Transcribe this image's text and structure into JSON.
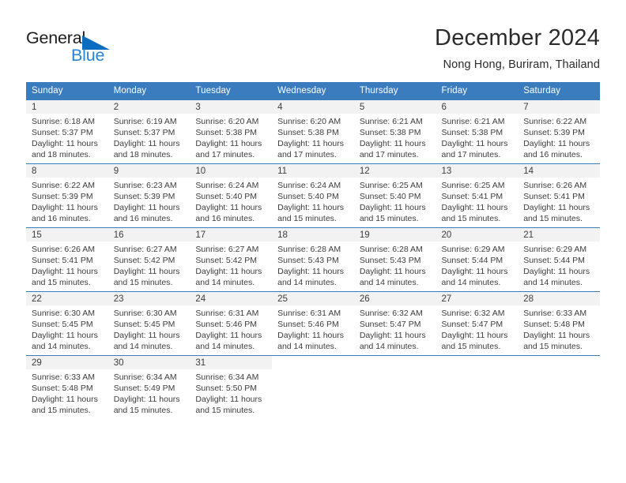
{
  "brand": {
    "word1": "General",
    "word2": "Blue",
    "triangle_color": "#0b6dc0",
    "blue_color": "#2585d3"
  },
  "header": {
    "month_title": "December 2024",
    "location": "Nong Hong, Buriram, Thailand"
  },
  "theme": {
    "header_bg": "#3a7cbe",
    "header_text": "#ffffff",
    "band_bg": "#f2f2f2",
    "text": "#3c3c3c"
  },
  "weekday_headers": [
    "Sunday",
    "Monday",
    "Tuesday",
    "Wednesday",
    "Thursday",
    "Friday",
    "Saturday"
  ],
  "weeks": [
    [
      {
        "day": "1",
        "sunrise": "Sunrise: 6:18 AM",
        "sunset": "Sunset: 5:37 PM",
        "daylight1": "Daylight: 11 hours",
        "daylight2": "and 18 minutes."
      },
      {
        "day": "2",
        "sunrise": "Sunrise: 6:19 AM",
        "sunset": "Sunset: 5:37 PM",
        "daylight1": "Daylight: 11 hours",
        "daylight2": "and 18 minutes."
      },
      {
        "day": "3",
        "sunrise": "Sunrise: 6:20 AM",
        "sunset": "Sunset: 5:38 PM",
        "daylight1": "Daylight: 11 hours",
        "daylight2": "and 17 minutes."
      },
      {
        "day": "4",
        "sunrise": "Sunrise: 6:20 AM",
        "sunset": "Sunset: 5:38 PM",
        "daylight1": "Daylight: 11 hours",
        "daylight2": "and 17 minutes."
      },
      {
        "day": "5",
        "sunrise": "Sunrise: 6:21 AM",
        "sunset": "Sunset: 5:38 PM",
        "daylight1": "Daylight: 11 hours",
        "daylight2": "and 17 minutes."
      },
      {
        "day": "6",
        "sunrise": "Sunrise: 6:21 AM",
        "sunset": "Sunset: 5:38 PM",
        "daylight1": "Daylight: 11 hours",
        "daylight2": "and 17 minutes."
      },
      {
        "day": "7",
        "sunrise": "Sunrise: 6:22 AM",
        "sunset": "Sunset: 5:39 PM",
        "daylight1": "Daylight: 11 hours",
        "daylight2": "and 16 minutes."
      }
    ],
    [
      {
        "day": "8",
        "sunrise": "Sunrise: 6:22 AM",
        "sunset": "Sunset: 5:39 PM",
        "daylight1": "Daylight: 11 hours",
        "daylight2": "and 16 minutes."
      },
      {
        "day": "9",
        "sunrise": "Sunrise: 6:23 AM",
        "sunset": "Sunset: 5:39 PM",
        "daylight1": "Daylight: 11 hours",
        "daylight2": "and 16 minutes."
      },
      {
        "day": "10",
        "sunrise": "Sunrise: 6:24 AM",
        "sunset": "Sunset: 5:40 PM",
        "daylight1": "Daylight: 11 hours",
        "daylight2": "and 16 minutes."
      },
      {
        "day": "11",
        "sunrise": "Sunrise: 6:24 AM",
        "sunset": "Sunset: 5:40 PM",
        "daylight1": "Daylight: 11 hours",
        "daylight2": "and 15 minutes."
      },
      {
        "day": "12",
        "sunrise": "Sunrise: 6:25 AM",
        "sunset": "Sunset: 5:40 PM",
        "daylight1": "Daylight: 11 hours",
        "daylight2": "and 15 minutes."
      },
      {
        "day": "13",
        "sunrise": "Sunrise: 6:25 AM",
        "sunset": "Sunset: 5:41 PM",
        "daylight1": "Daylight: 11 hours",
        "daylight2": "and 15 minutes."
      },
      {
        "day": "14",
        "sunrise": "Sunrise: 6:26 AM",
        "sunset": "Sunset: 5:41 PM",
        "daylight1": "Daylight: 11 hours",
        "daylight2": "and 15 minutes."
      }
    ],
    [
      {
        "day": "15",
        "sunrise": "Sunrise: 6:26 AM",
        "sunset": "Sunset: 5:41 PM",
        "daylight1": "Daylight: 11 hours",
        "daylight2": "and 15 minutes."
      },
      {
        "day": "16",
        "sunrise": "Sunrise: 6:27 AM",
        "sunset": "Sunset: 5:42 PM",
        "daylight1": "Daylight: 11 hours",
        "daylight2": "and 15 minutes."
      },
      {
        "day": "17",
        "sunrise": "Sunrise: 6:27 AM",
        "sunset": "Sunset: 5:42 PM",
        "daylight1": "Daylight: 11 hours",
        "daylight2": "and 14 minutes."
      },
      {
        "day": "18",
        "sunrise": "Sunrise: 6:28 AM",
        "sunset": "Sunset: 5:43 PM",
        "daylight1": "Daylight: 11 hours",
        "daylight2": "and 14 minutes."
      },
      {
        "day": "19",
        "sunrise": "Sunrise: 6:28 AM",
        "sunset": "Sunset: 5:43 PM",
        "daylight1": "Daylight: 11 hours",
        "daylight2": "and 14 minutes."
      },
      {
        "day": "20",
        "sunrise": "Sunrise: 6:29 AM",
        "sunset": "Sunset: 5:44 PM",
        "daylight1": "Daylight: 11 hours",
        "daylight2": "and 14 minutes."
      },
      {
        "day": "21",
        "sunrise": "Sunrise: 6:29 AM",
        "sunset": "Sunset: 5:44 PM",
        "daylight1": "Daylight: 11 hours",
        "daylight2": "and 14 minutes."
      }
    ],
    [
      {
        "day": "22",
        "sunrise": "Sunrise: 6:30 AM",
        "sunset": "Sunset: 5:45 PM",
        "daylight1": "Daylight: 11 hours",
        "daylight2": "and 14 minutes."
      },
      {
        "day": "23",
        "sunrise": "Sunrise: 6:30 AM",
        "sunset": "Sunset: 5:45 PM",
        "daylight1": "Daylight: 11 hours",
        "daylight2": "and 14 minutes."
      },
      {
        "day": "24",
        "sunrise": "Sunrise: 6:31 AM",
        "sunset": "Sunset: 5:46 PM",
        "daylight1": "Daylight: 11 hours",
        "daylight2": "and 14 minutes."
      },
      {
        "day": "25",
        "sunrise": "Sunrise: 6:31 AM",
        "sunset": "Sunset: 5:46 PM",
        "daylight1": "Daylight: 11 hours",
        "daylight2": "and 14 minutes."
      },
      {
        "day": "26",
        "sunrise": "Sunrise: 6:32 AM",
        "sunset": "Sunset: 5:47 PM",
        "daylight1": "Daylight: 11 hours",
        "daylight2": "and 14 minutes."
      },
      {
        "day": "27",
        "sunrise": "Sunrise: 6:32 AM",
        "sunset": "Sunset: 5:47 PM",
        "daylight1": "Daylight: 11 hours",
        "daylight2": "and 15 minutes."
      },
      {
        "day": "28",
        "sunrise": "Sunrise: 6:33 AM",
        "sunset": "Sunset: 5:48 PM",
        "daylight1": "Daylight: 11 hours",
        "daylight2": "and 15 minutes."
      }
    ],
    [
      {
        "day": "29",
        "sunrise": "Sunrise: 6:33 AM",
        "sunset": "Sunset: 5:48 PM",
        "daylight1": "Daylight: 11 hours",
        "daylight2": "and 15 minutes."
      },
      {
        "day": "30",
        "sunrise": "Sunrise: 6:34 AM",
        "sunset": "Sunset: 5:49 PM",
        "daylight1": "Daylight: 11 hours",
        "daylight2": "and 15 minutes."
      },
      {
        "day": "31",
        "sunrise": "Sunrise: 6:34 AM",
        "sunset": "Sunset: 5:50 PM",
        "daylight1": "Daylight: 11 hours",
        "daylight2": "and 15 minutes."
      },
      {
        "day": "",
        "sunrise": "",
        "sunset": "",
        "daylight1": "",
        "daylight2": ""
      },
      {
        "day": "",
        "sunrise": "",
        "sunset": "",
        "daylight1": "",
        "daylight2": ""
      },
      {
        "day": "",
        "sunrise": "",
        "sunset": "",
        "daylight1": "",
        "daylight2": ""
      },
      {
        "day": "",
        "sunrise": "",
        "sunset": "",
        "daylight1": "",
        "daylight2": ""
      }
    ]
  ]
}
